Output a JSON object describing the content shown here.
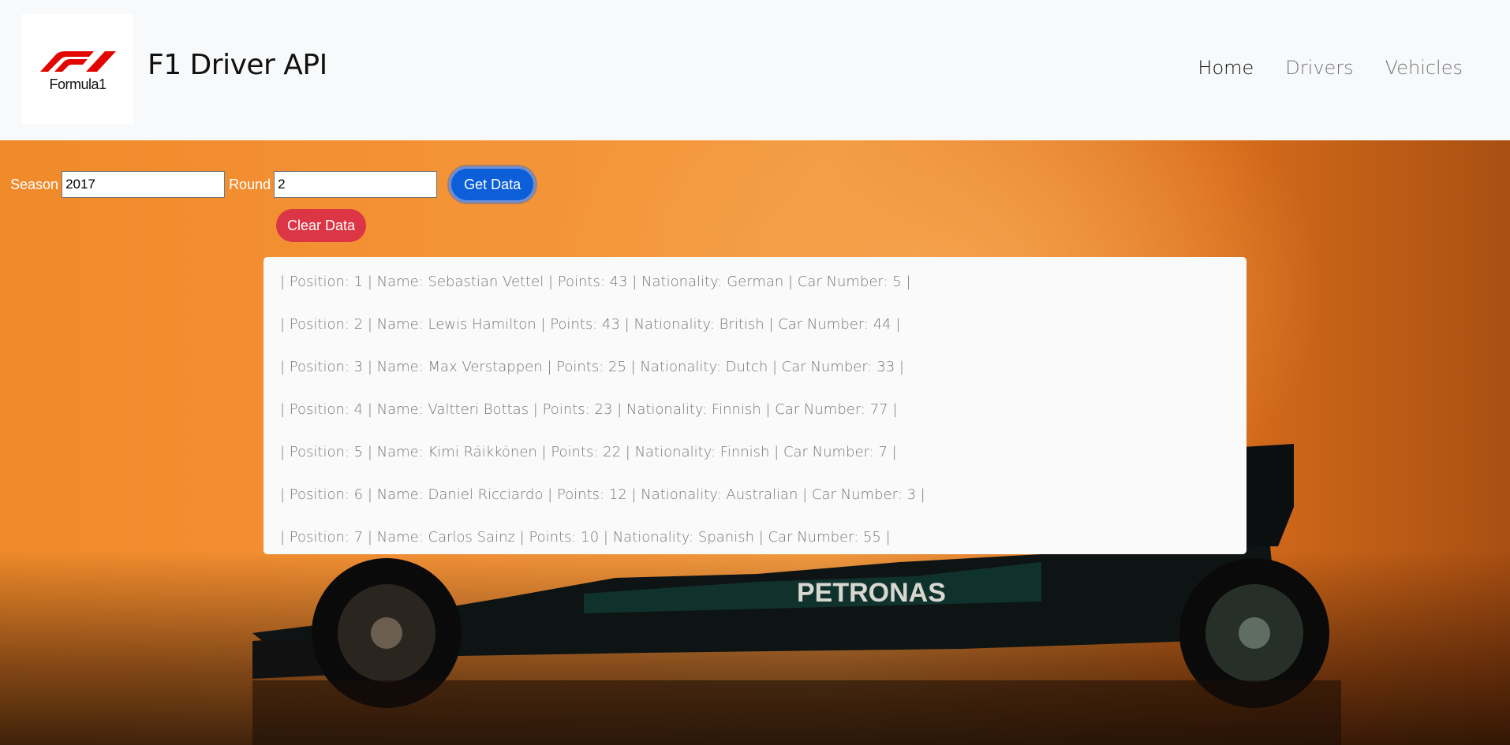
{
  "navbar": {
    "logo_text": "Formula1",
    "brand": "F1 Driver API",
    "links": [
      {
        "label": "Home",
        "active": true
      },
      {
        "label": "Drivers",
        "active": false
      },
      {
        "label": "Vehicles",
        "active": false
      }
    ]
  },
  "form": {
    "season_label": "Season",
    "season_value": "2017",
    "round_label": "Round",
    "round_value": "2",
    "get_button": "Get Data",
    "clear_button": "Clear Data"
  },
  "results": [
    "| Position: 1 | Name: Sebastian Vettel | Points: 43 | Nationality: German | Car Number: 5 |",
    "| Position: 2 | Name: Lewis Hamilton | Points: 43 | Nationality: British | Car Number: 44 |",
    "| Position: 3 | Name: Max Verstappen | Points: 25 | Nationality: Dutch | Car Number: 33 |",
    "| Position: 4 | Name: Valtteri Bottas | Points: 23 | Nationality: Finnish | Car Number: 77 |",
    "| Position: 5 | Name: Kimi Räikkönen | Points: 22 | Nationality: Finnish | Car Number: 7 |",
    "| Position: 6 | Name: Daniel Ricciardo | Points: 12 | Nationality: Australian | Car Number: 3 |",
    "| Position: 7 | Name: Carlos Sainz | Points: 10 | Nationality: Spanish | Car Number: 55 |"
  ],
  "background": {
    "car_text": "PETRONAS",
    "car_text_partial": "ON"
  },
  "colors": {
    "get_button": "#0d5fd9",
    "clear_button": "#dc3545",
    "f1_red": "#e10600",
    "hero_orange": "#f39a3f"
  }
}
